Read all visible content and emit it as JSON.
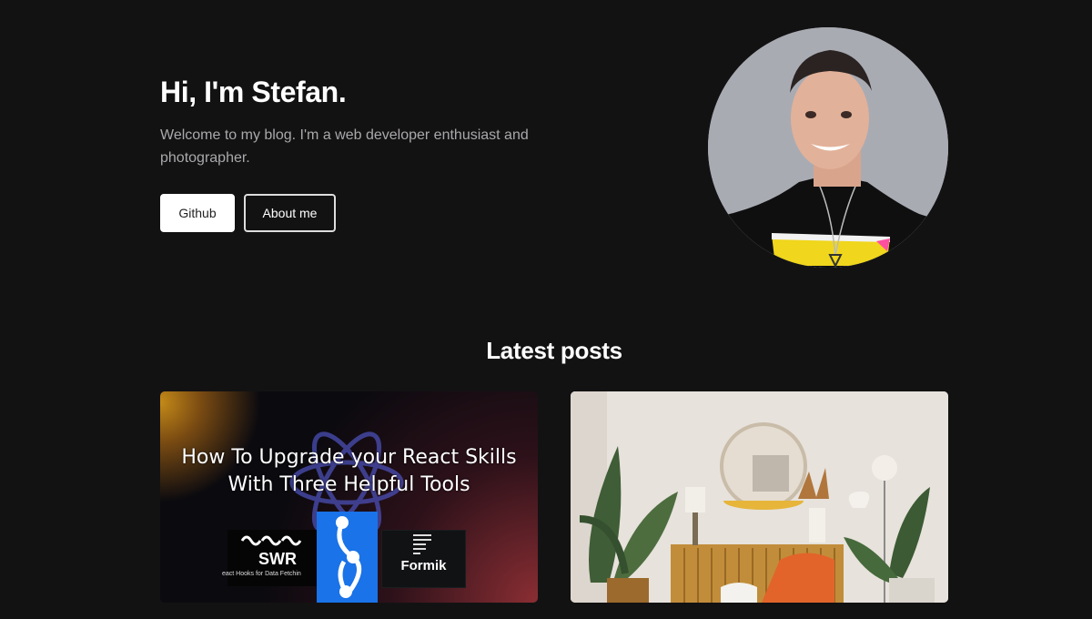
{
  "hero": {
    "title": "Hi, I'm Stefan.",
    "intro": "Welcome to my blog. I'm a web developer enthusiast and photographer.",
    "github_label": "Github",
    "about_label": "About me"
  },
  "section": {
    "title": "Latest posts"
  },
  "posts": [
    {
      "title_line1": "How To Upgrade your React Skills",
      "title_line2": "With Three Helpful Tools",
      "swr_name": "SWR",
      "swr_sub": "eact Hooks for Data Fetchin",
      "formik_name": "Formik"
    },
    {
      "image": "interior-photo"
    }
  ],
  "colors": {
    "background": "#131213",
    "muted_text": "#a9a8aa",
    "accent_blue": "#1a73e8"
  }
}
